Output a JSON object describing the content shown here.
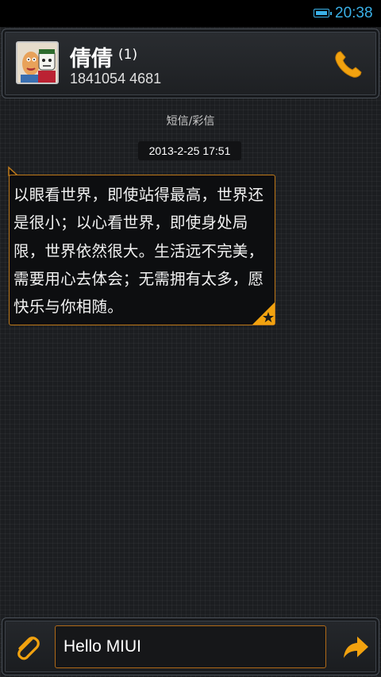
{
  "status_bar": {
    "time": "20:38",
    "battery_icon": "battery-icon"
  },
  "header": {
    "contact_name": "倩倩",
    "unread_count": "(1)",
    "phone_number": "1841054 4681",
    "call_icon": "phone-icon",
    "avatar_icon": "avatar-icon"
  },
  "conversation": {
    "message_type": "短信/彩信",
    "timestamp": "2013-2-25 17:51",
    "messages": [
      {
        "text": "以眼看世界，即使站得最高，世界还是很小；以心看世界，即使身处局限，世界依然很大。生活远不完美，需要用心去体会；无需拥有太多，愿快乐与你相随。",
        "starred": true
      }
    ]
  },
  "composer": {
    "input_value": "Hello MIUI",
    "attach_icon": "paperclip-icon",
    "send_icon": "send-arrow-icon"
  },
  "colors": {
    "accent": "#f2a20f",
    "status_blue": "#3ab0e6",
    "bubble_border": "#c07a1a"
  }
}
